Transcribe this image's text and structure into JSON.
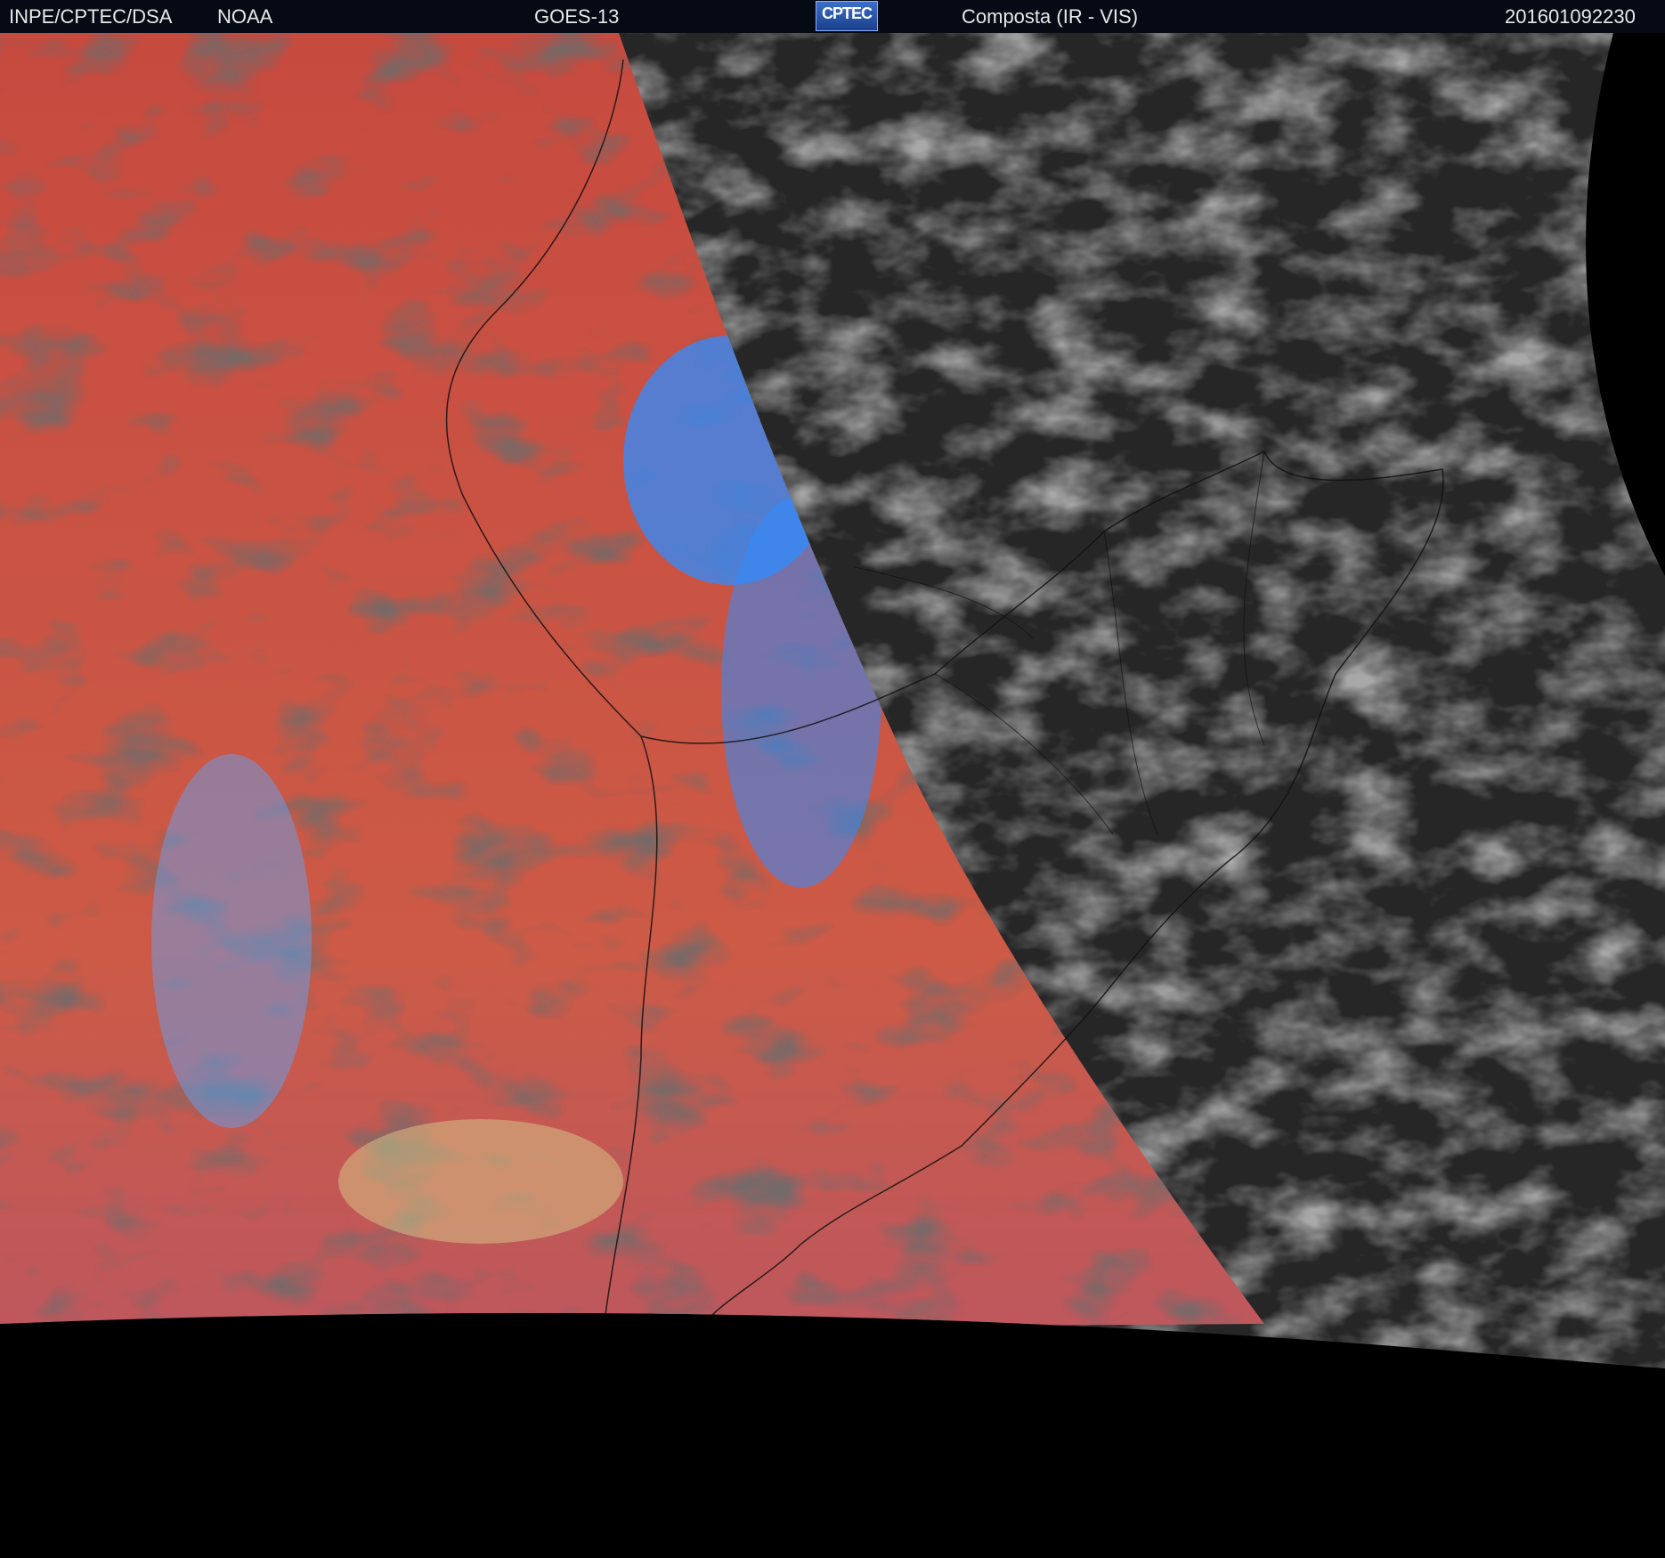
{
  "header": {
    "agency": "INPE/CPTEC/DSA",
    "partner": "NOAA",
    "satellite": "GOES-13",
    "logo_text": "CPTEC",
    "product": "Composta (IR - VIS)",
    "timestamp": "201601092230"
  },
  "colors": {
    "header_bg": "#050a14",
    "ir_warm": "#c8483c",
    "ir_cold": "#2b8cff",
    "vis_gray": "#2a2a2a",
    "space": "#000000"
  }
}
